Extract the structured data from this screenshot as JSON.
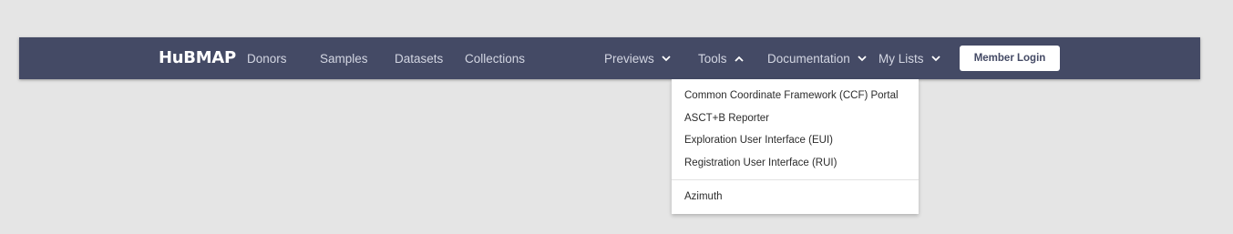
{
  "nav": {
    "logo": "HuBMAP",
    "links": [
      "Donors",
      "Samples",
      "Datasets",
      "Collections"
    ],
    "menus": [
      "Previews",
      "Tools",
      "Documentation",
      "My Lists"
    ],
    "login_label": "Member Login"
  },
  "tools_menu": {
    "items": [
      "Common Coordinate Framework (CCF) Portal",
      "ASCT+B Reporter",
      "Exploration User Interface (EUI)",
      "Registration User Interface (RUI)",
      "Azimuth"
    ]
  },
  "colors": {
    "navbar": "#444a65",
    "page_background": "#e5e5e5",
    "nav_text": "#d3d6e2"
  }
}
